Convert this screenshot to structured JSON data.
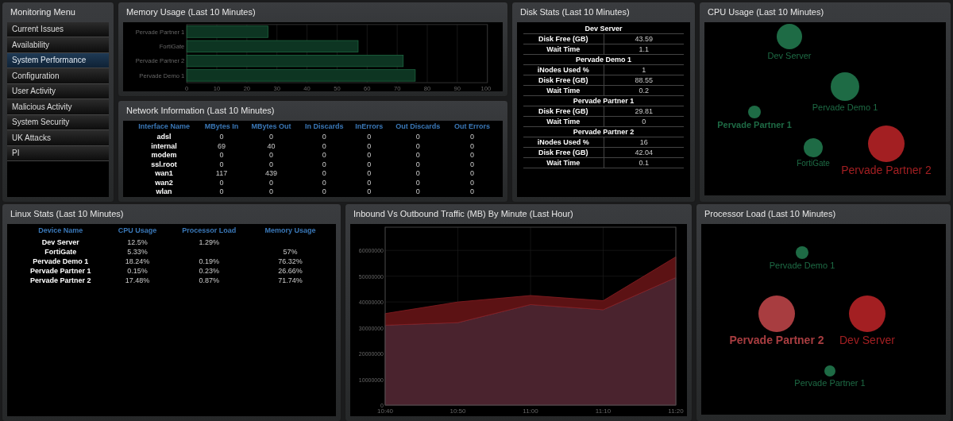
{
  "menu": {
    "title": "Monitoring Menu",
    "items": [
      {
        "label": "Current Issues",
        "selected": false
      },
      {
        "label": "Availability",
        "selected": false
      },
      {
        "label": "System Performance",
        "selected": true
      },
      {
        "label": "Configuration",
        "selected": false
      },
      {
        "label": "User Activity",
        "selected": false
      },
      {
        "label": "Malicious Activity",
        "selected": false
      },
      {
        "label": "System Security",
        "selected": false
      },
      {
        "label": "UK Attacks",
        "selected": false
      },
      {
        "label": "PI",
        "selected": false
      }
    ]
  },
  "memory": {
    "title": "Memory Usage (Last 10 Minutes)",
    "chart_data": {
      "type": "bar",
      "orientation": "horizontal",
      "categories": [
        "Pervade Partner 1",
        "FortiGate",
        "Pervade Partner 2",
        "Pervade Demo 1"
      ],
      "values": [
        27,
        57,
        72,
        76
      ],
      "grid": true,
      "xlim": [
        0,
        100
      ],
      "xticks": [
        0,
        10,
        20,
        30,
        40,
        50,
        60,
        70,
        80,
        90,
        100
      ]
    }
  },
  "network": {
    "title": "Network Information (Last 10 Minutes)",
    "columns": [
      "Interface Name",
      "MBytes In",
      "MBytes Out",
      "In Discards",
      "InErrors",
      "Out Discards",
      "Out Errors"
    ],
    "rows": [
      [
        "adsl",
        "0",
        "0",
        "0",
        "0",
        "0",
        "0"
      ],
      [
        "internal",
        "69",
        "40",
        "0",
        "0",
        "0",
        "0"
      ],
      [
        "modem",
        "0",
        "0",
        "0",
        "0",
        "0",
        "0"
      ],
      [
        "ssl.root",
        "0",
        "0",
        "0",
        "0",
        "0",
        "0"
      ],
      [
        "wan1",
        "117",
        "439",
        "0",
        "0",
        "0",
        "0"
      ],
      [
        "wan2",
        "0",
        "0",
        "0",
        "0",
        "0",
        "0"
      ],
      [
        "wlan",
        "0",
        "0",
        "0",
        "0",
        "0",
        "0"
      ]
    ]
  },
  "disk": {
    "title": "Disk Stats (Last 10 Minutes)",
    "groups": [
      {
        "name": "Dev Server",
        "rows": [
          {
            "label": "Disk Free (GB)",
            "value": "43.59"
          },
          {
            "label": "Wait Time",
            "value": "1.1"
          }
        ]
      },
      {
        "name": "Pervade Demo 1",
        "rows": [
          {
            "label": "iNodes Used %",
            "value": "1"
          },
          {
            "label": "Disk Free (GB)",
            "value": "88.55"
          },
          {
            "label": "Wait Time",
            "value": "0.2"
          }
        ]
      },
      {
        "name": "Pervade Partner 1",
        "rows": [
          {
            "label": "Disk Free (GB)",
            "value": "29.81"
          },
          {
            "label": "Wait Time",
            "value": "0"
          }
        ]
      },
      {
        "name": "Pervade Partner 2",
        "rows": [
          {
            "label": "iNodes Used %",
            "value": "16"
          },
          {
            "label": "Disk Free (GB)",
            "value": "42.04"
          },
          {
            "label": "Wait Time",
            "value": "0.1"
          }
        ]
      }
    ]
  },
  "cpu": {
    "title": "CPU Usage (Last 10 Minutes)",
    "bubbles": [
      {
        "label": "Dev Server",
        "color": "#1e6b45",
        "emphasized": false
      },
      {
        "label": "Pervade Demo 1",
        "color": "#1e6b45",
        "emphasized": false
      },
      {
        "label": "Pervade Partner 1",
        "color": "#1e6b45",
        "emphasized": true
      },
      {
        "label": "FortiGate",
        "color": "#1e6b45",
        "emphasized": false
      },
      {
        "label": "Pervade Partner 2",
        "color": "#a31f22",
        "emphasized": false
      }
    ]
  },
  "linux": {
    "title": "Linux Stats (Last 10 Minutes)",
    "columns": [
      "Device Name",
      "CPU Usage",
      "Processor Load",
      "Memory Usage"
    ],
    "rows": [
      [
        "Dev Server",
        "12.5%",
        "1.29%",
        ""
      ],
      [
        "FortiGate",
        "5.33%",
        "",
        "57%"
      ],
      [
        "Pervade Demo 1",
        "18.24%",
        "0.19%",
        "76.32%"
      ],
      [
        "Pervade Partner 1",
        "0.15%",
        "0.23%",
        "26.66%"
      ],
      [
        "Pervade Partner 2",
        "17.48%",
        "0.87%",
        "71.74%"
      ]
    ]
  },
  "traffic": {
    "title": "Inbound Vs Outbound Traffic (MB) By Minute (Last Hour)",
    "chart_data": {
      "type": "area",
      "stacked": true,
      "grid": true,
      "x": [
        "10:40",
        "10:50",
        "11:00",
        "11:10",
        "11:20"
      ],
      "series": [
        {
          "color": "#4a232e",
          "values": [
            31000000,
            32000000,
            39000000,
            37000000,
            49500000
          ]
        },
        {
          "color": "#5c1214",
          "values": [
            4500000,
            8000000,
            3500000,
            3500000,
            8000000
          ]
        }
      ],
      "ylim": [
        0,
        69000000
      ],
      "yticks": [
        0,
        10000000,
        20000000,
        30000000,
        40000000,
        50000000,
        60000000
      ]
    }
  },
  "processor": {
    "title": "Processor Load (Last 10 Minutes)",
    "bubbles": [
      {
        "label": "Pervade Demo 1",
        "color": "#1e6b45",
        "emphasized": false
      },
      {
        "label": "Pervade Partner 2",
        "color": "#a83d40",
        "emphasized": true
      },
      {
        "label": "Dev Server",
        "color": "#a31f22",
        "emphasized": false
      },
      {
        "label": "Pervade Partner 1",
        "color": "#1e6b45",
        "emphasized": false
      }
    ]
  }
}
